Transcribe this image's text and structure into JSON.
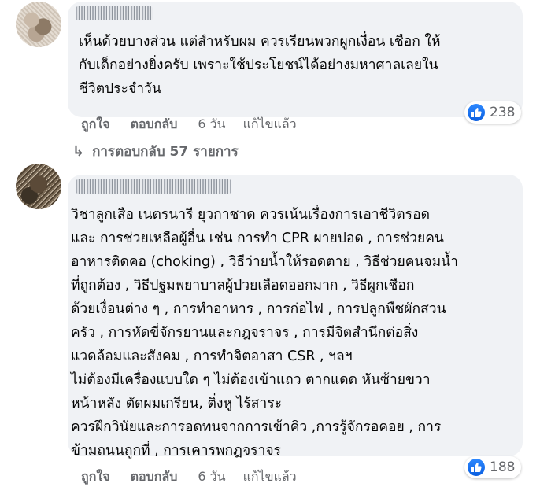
{
  "comment1": {
    "text": "เห็นด้วยบางส่วน แต่สำหรับผม ควรเรียนพวกผูกเงื่อน เชือก ให้\nกับเด็กอย่างยิ่งครับ เพราะใช้ประโยชน์ได้อย่างมหาศาลเลยใน\nชีวิตประจำวัน",
    "reaction_count": "238",
    "like_label": "ถูกใจ",
    "reply_label": "ตอบกลับ",
    "time": "6 วัน",
    "edited": "แก้ไขแล้ว",
    "replies_label": "การตอบกลับ 57 รายการ"
  },
  "comment2": {
    "text": "วิชาลูกเสือ เนตรนารี ยุวกาชาด ควรเน้นเรื่องการเอาชีวิตรอด\nและ การช่วยเหลือผู้อื่น เช่น การทำ CPR ผายปอด , การช่วยคน\nอาหารติดคอ (choking) , วิธีว่ายน้ำให้รอดตาย , วิธีช่วยคนจมน้ำ\nที่ถูกต้อง , วิธีปฐมพยาบาลผู้ป่วยเลือดออกมาก , วิธีผูกเชือก\nด้วยเงื่อนต่าง ๆ , การทำอาหาร , การก่อไฟ , การปลูกพืชผักสวน\nครัว , การหัดขี่จักรยานและกฎจราจร , การมีจิตสำนึกต่อสิ่ง\nแวดล้อมและสังคม , การทำจิตอาสา CSR , ฯลฯ\nไม่ต้องมีเครื่องแบบใด ๆ ไม่ต้องเข้าแถว ตากแดด หันซ้ายขวา\nหน้าหลัง ตัดผมเกรียน, ติ่งหู ไร้สาระ\nควรฝึกวินัยและการอดทนจากการเข้าคิว ,การรู้จักรอคอย , การ\nข้ามถนนถูกที่ , การเคารพกฎจราจร",
    "reaction_count": "188",
    "like_label": "ถูกใจ",
    "reply_label": "ตอบกลับ",
    "time": "6 วัน",
    "edited": "แก้ไขแล้ว"
  },
  "icons": {
    "like": "thumbs-up-icon",
    "reply_arrow": "reply-arrow-icon"
  },
  "colors": {
    "bubble": "#f0f2f5",
    "secondary_text": "#65676b",
    "like_blue": "#1877f2"
  }
}
